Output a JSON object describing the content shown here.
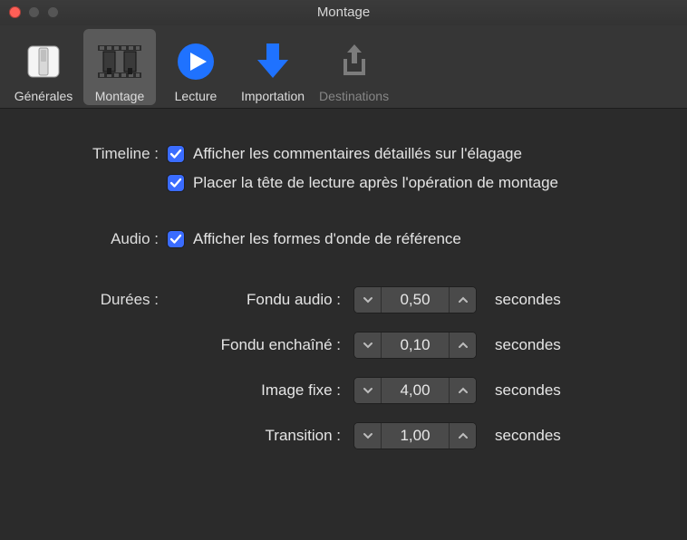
{
  "window": {
    "title": "Montage"
  },
  "toolbar": {
    "items": [
      {
        "label": "Générales"
      },
      {
        "label": "Montage"
      },
      {
        "label": "Lecture"
      },
      {
        "label": "Importation"
      },
      {
        "label": "Destinations"
      }
    ]
  },
  "timeline": {
    "label": "Timeline :",
    "options": [
      "Afficher les commentaires détaillés sur l'élagage",
      "Placer la tête de lecture après l'opération de montage"
    ]
  },
  "audio": {
    "label": "Audio :",
    "option": "Afficher les formes d'onde de référence"
  },
  "durations": {
    "label": "Durées :",
    "items": [
      {
        "label": "Fondu audio :",
        "value": "0,50",
        "unit": "secondes"
      },
      {
        "label": "Fondu enchaîné :",
        "value": "0,10",
        "unit": "secondes"
      },
      {
        "label": "Image fixe :",
        "value": "4,00",
        "unit": "secondes"
      },
      {
        "label": "Transition :",
        "value": "1,00",
        "unit": "secondes"
      }
    ]
  }
}
